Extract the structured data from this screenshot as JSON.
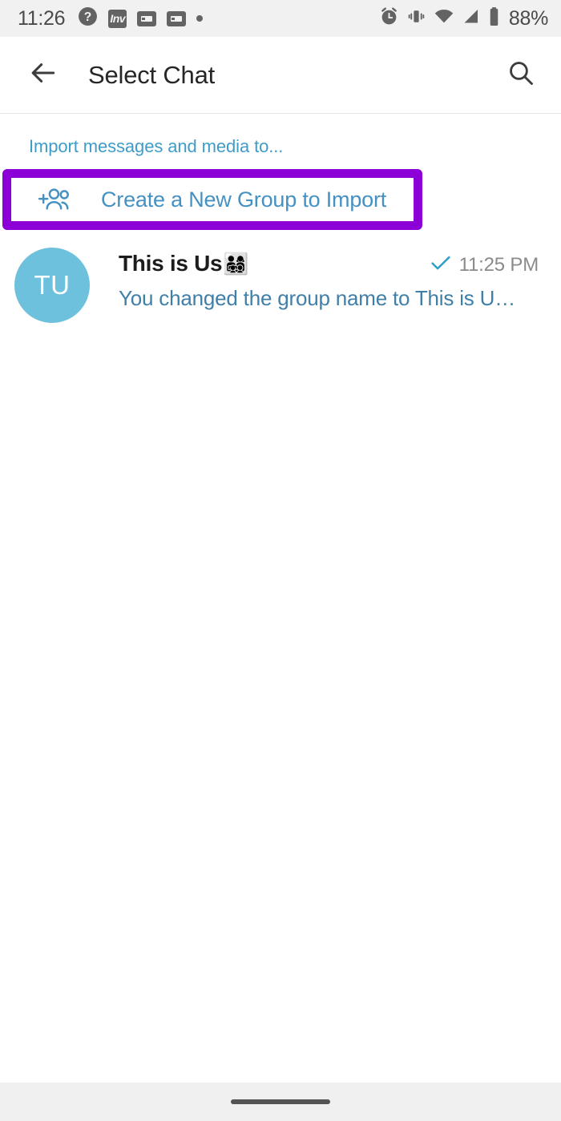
{
  "status_bar": {
    "time": "11:26",
    "battery_percent": "88%",
    "left_icons": [
      "help-circle-icon",
      "inv-badge-icon",
      "card-badge-icon",
      "card-badge-icon",
      "dot-icon"
    ],
    "inv_badge_label": "Inv",
    "right_icons": [
      "alarm-icon",
      "vibrate-icon",
      "wifi-icon",
      "signal-icon",
      "battery-icon"
    ],
    "background_color": "#f1f1f1"
  },
  "toolbar": {
    "back_icon": "arrow-left-icon",
    "title": "Select Chat",
    "search_icon": "search-icon"
  },
  "content": {
    "section_header": "Import messages and media to...",
    "new_group": {
      "icon": "add-group-icon",
      "label": "Create a New Group to Import",
      "highlight_color": "#8c00d7",
      "text_color": "#4491c2"
    },
    "chats": [
      {
        "avatar_initials": "TU",
        "avatar_color": "#6ec1dd",
        "title": "This is Us",
        "title_emoji": "👨‍👩‍👧‍👦",
        "status_icon": "check-icon",
        "time": "11:25 PM",
        "snippet": "You changed the group name to This is U…"
      }
    ]
  },
  "nav_bar": {
    "gesture_pill": "home-indicator"
  }
}
